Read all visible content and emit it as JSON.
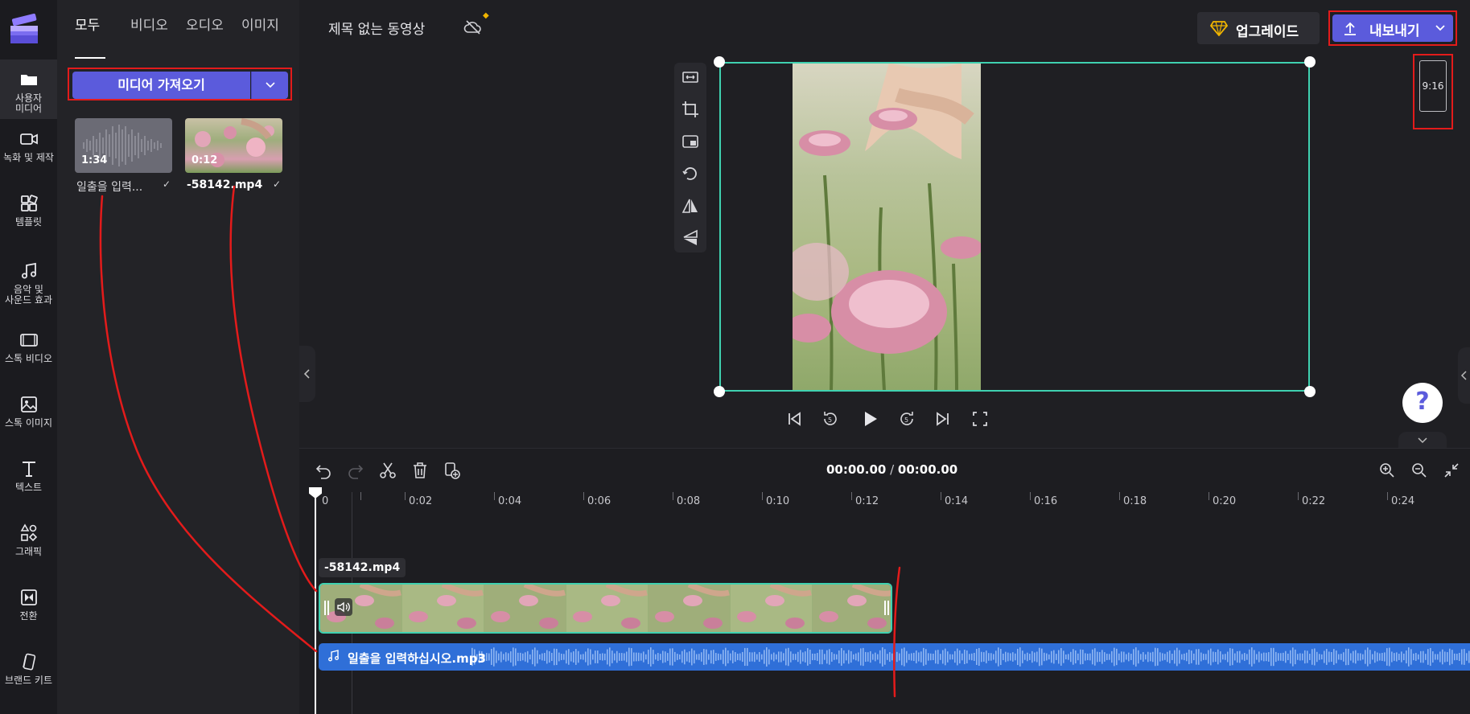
{
  "rail": {
    "items": [
      {
        "label": "사용자 미디어",
        "icon": "folder-icon"
      },
      {
        "label": "녹화 및 제작",
        "icon": "video-camera-icon"
      },
      {
        "label": "템플릿",
        "icon": "templates-icon"
      },
      {
        "label": "음악 및 사운드 효과",
        "icon": "music-note-icon"
      },
      {
        "label": "스톡 비디오",
        "icon": "film-icon"
      },
      {
        "label": "스톡 이미지",
        "icon": "image-icon"
      },
      {
        "label": "텍스트",
        "icon": "text-icon"
      },
      {
        "label": "그래픽",
        "icon": "shapes-icon"
      },
      {
        "label": "전환",
        "icon": "transition-icon"
      },
      {
        "label": "브랜드 키트",
        "icon": "brand-kit-icon"
      }
    ]
  },
  "media": {
    "tabs": [
      {
        "label": "모두"
      },
      {
        "label": "비디오"
      },
      {
        "label": "오디오"
      },
      {
        "label": "이미지"
      }
    ],
    "import_label": "미디어 가져오기",
    "assets": [
      {
        "name": "일출을 입력...",
        "duration": "1:34",
        "type": "audio"
      },
      {
        "name": "-58142.mp4",
        "duration": "0:12",
        "type": "video"
      }
    ]
  },
  "header": {
    "title": "제목 없는 동영상",
    "upgrade_label": "업그레이드",
    "export_label": "내보내기",
    "aspect_ratio": "9:16"
  },
  "help_label": "?",
  "timeline": {
    "time_current": "00:00.00",
    "separator": " / ",
    "time_total": "00:00.00",
    "ruler": [
      "0",
      "0:02",
      "0:04",
      "0:06",
      "0:08",
      "0:10",
      "0:12",
      "0:14",
      "0:16",
      "0:18",
      "0:20",
      "0:22",
      "0:24"
    ],
    "video_clip_label": "-58142.mp4",
    "audio_clip_label": "일출을 입력하십시오.mp3"
  },
  "colors": {
    "accent": "#5b5bdc",
    "selection": "#3fd1b0",
    "audio": "#2f6fd8",
    "annotation": "#e31b1b"
  }
}
